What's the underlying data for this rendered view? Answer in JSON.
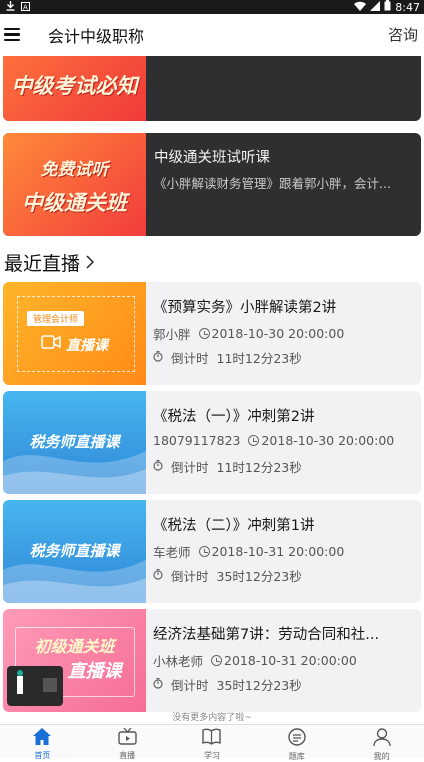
{
  "status_bar": {
    "time": "8:47"
  },
  "header": {
    "title": "会计中级职称",
    "consult": "咨询"
  },
  "top_cards": [
    {
      "thumb_lines": [
        "中级考试必知"
      ]
    },
    {
      "thumb_lines": [
        "免费试听",
        "中级通关班"
      ],
      "title": "中级通关班试听课",
      "subtitle": "《小胖解读财务管理》跟着郭小胖，会计..."
    }
  ],
  "section": {
    "title": "最近直播",
    "arrow": "›"
  },
  "live_list": [
    {
      "thumb": {
        "badge": "管理会计师",
        "text": "直播课"
      },
      "title": "《预算实务》小胖解读第2讲",
      "teacher": "郭小胖",
      "datetime": "2018-10-30 20:00:00",
      "countdown_label": "倒计时",
      "countdown": "11时12分23秒"
    },
    {
      "thumb": {
        "text": "税务师直播课"
      },
      "title": "《税法（一）》冲刺第2讲",
      "teacher": "18079117823",
      "datetime": "2018-10-30 20:00:00",
      "countdown_label": "倒计时",
      "countdown": "11时12分23秒"
    },
    {
      "thumb": {
        "text": "税务师直播课"
      },
      "title": "《税法（二）》冲刺第1讲",
      "teacher": "车老师",
      "datetime": "2018-10-31 20:00:00",
      "countdown_label": "倒计时",
      "countdown": "35时12分23秒"
    },
    {
      "thumb": {
        "line1": "初级通关班",
        "line2": "直播课"
      },
      "title": "经济法基础第7讲：劳动合同和社...",
      "teacher": "小林老师",
      "datetime": "2018-10-31 20:00:00",
      "countdown_label": "倒计时",
      "countdown": "35时12分23秒"
    }
  ],
  "footer_note": "没有更多内容了啦~",
  "tabs": [
    {
      "label": "首页",
      "icon": "home-icon",
      "active": true
    },
    {
      "label": "直播",
      "icon": "tv-icon"
    },
    {
      "label": "学习",
      "icon": "book-icon"
    },
    {
      "label": "题库",
      "icon": "question-bank-icon"
    },
    {
      "label": "我的",
      "icon": "person-icon"
    }
  ],
  "colors": {
    "accent": "#1a6fd6",
    "dark_card": "#2f2f31",
    "light_card": "#f2f2f4",
    "orange": "#ff9a1f",
    "blue": "#3aa0e6",
    "red": "#f04a3e",
    "pink": "#f77fa2"
  }
}
